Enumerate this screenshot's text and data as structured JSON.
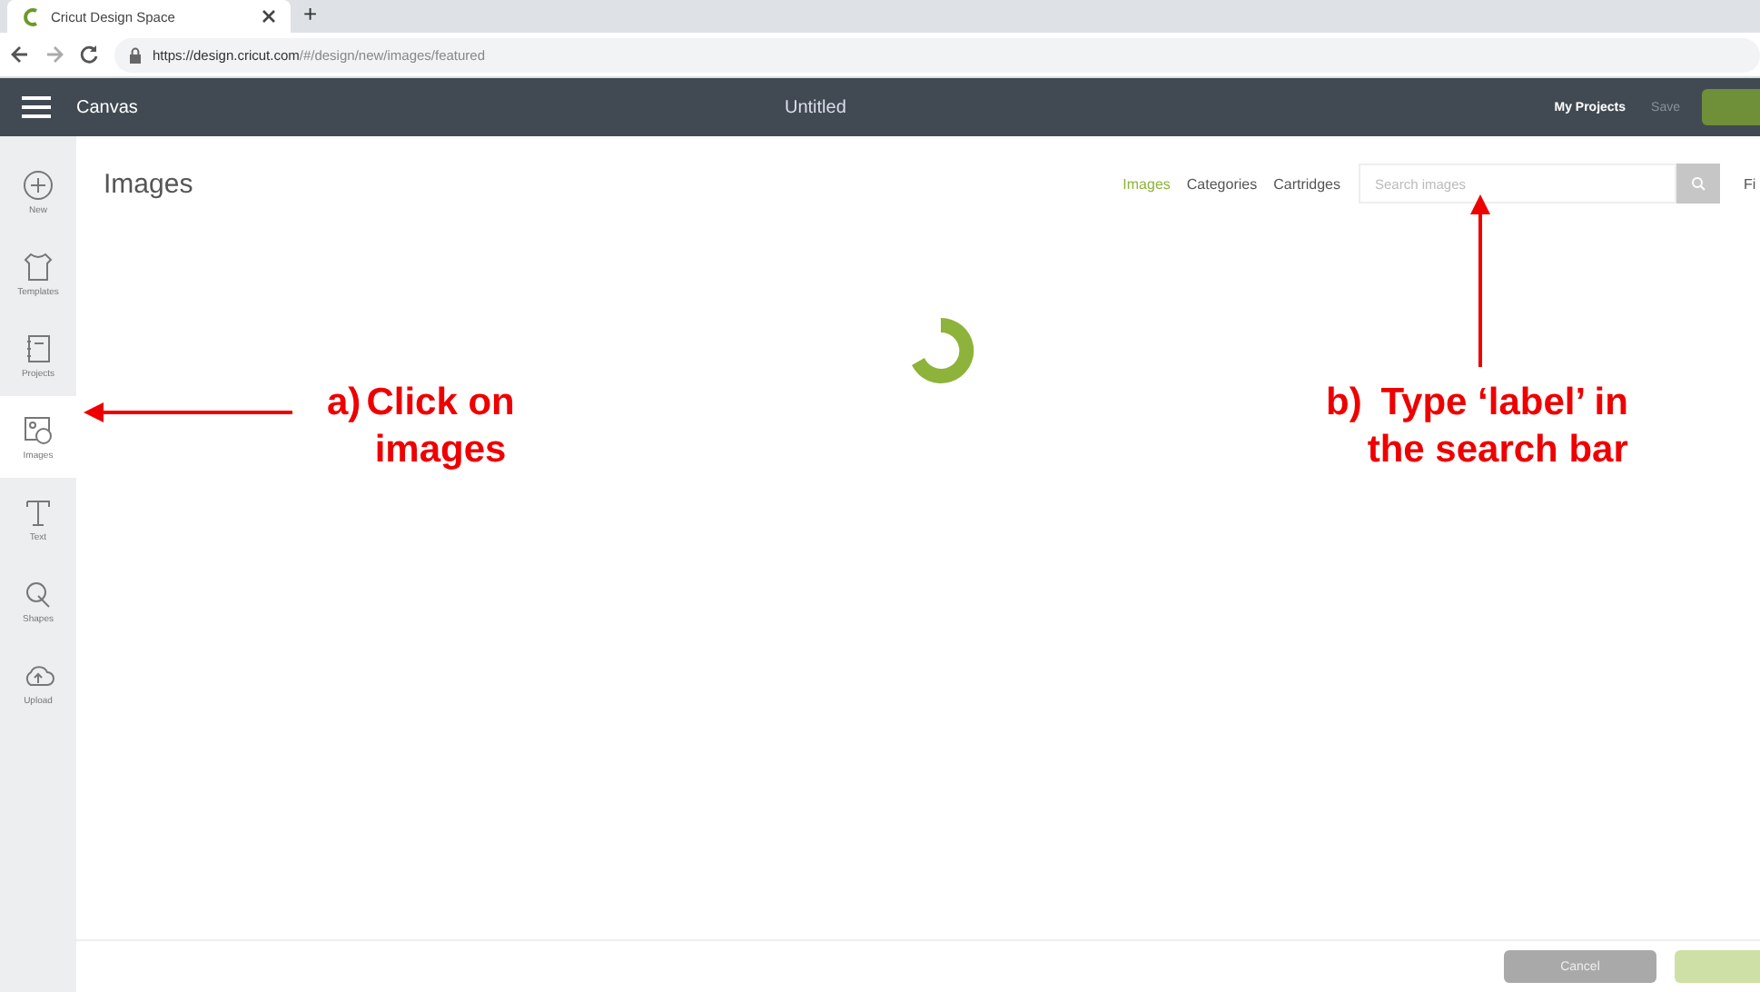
{
  "browser": {
    "tab_title": "Cricut Design Space",
    "new_tab": "+",
    "url_host": "https://design.cricut.com",
    "url_path": "/#/design/new/images/featured"
  },
  "app_header": {
    "title": "Canvas",
    "document": "Untitled",
    "my_projects": "My Projects",
    "save": {
      "label": "Save",
      "disabled": true
    }
  },
  "sidebar": {
    "items": [
      {
        "label": "New",
        "selected": false
      },
      {
        "label": "Templates",
        "selected": false
      },
      {
        "label": "Projects",
        "selected": false
      },
      {
        "label": "Images",
        "selected": true
      },
      {
        "label": "Text",
        "selected": false
      },
      {
        "label": "Shapes",
        "selected": false
      },
      {
        "label": "Upload",
        "selected": false
      }
    ]
  },
  "page": {
    "title": "Images",
    "nav": [
      {
        "label": "Images",
        "selected": true
      },
      {
        "label": "Categories",
        "selected": false
      },
      {
        "label": "Cartridges",
        "selected": false
      }
    ],
    "search": {
      "placeholder": "Search images"
    },
    "filter": "Fi"
  },
  "annotations": [
    {
      "kind": "left",
      "marker": "a)",
      "lines": [
        "Click on",
        "images"
      ]
    },
    {
      "kind": "up",
      "marker": "b)",
      "lines": [
        "Type ‘label’ in",
        "the search bar"
      ]
    }
  ],
  "footer": {
    "cancel": "Cancel"
  }
}
